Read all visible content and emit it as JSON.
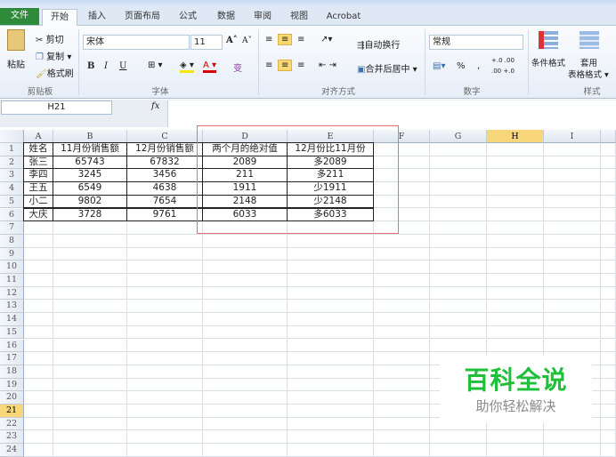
{
  "tabs": [
    "文件",
    "开始",
    "插入",
    "页面布局",
    "公式",
    "数据",
    "审阅",
    "视图",
    "Acrobat"
  ],
  "ribbon": {
    "clipboard": {
      "paste": "粘贴",
      "cut": "剪切",
      "copy": "复制 ▾",
      "format_painter": "格式刷",
      "label": "剪贴板"
    },
    "font": {
      "name": "宋体",
      "size": "11",
      "grow": "A˄",
      "shrink": "A˅",
      "bold": "B",
      "italic": "I",
      "underline": "U",
      "label": "字体",
      "wen": "变"
    },
    "alignment": {
      "wrap": "自动换行",
      "merge": "合并后居中 ▾",
      "label": "对齐方式"
    },
    "number": {
      "format": "常规",
      "percent": "%",
      "comma": ",",
      "inc": "+.0 .00",
      "dec": ".00 +.0",
      "label": "数字"
    },
    "styles": {
      "conditional": "条件格式",
      "table": "套用",
      "table2": "表格格式 ▾",
      "label": "样式"
    }
  },
  "formula_bar": {
    "name_box": "H21",
    "fx": "fx",
    "value": ""
  },
  "sheet": {
    "columns": [
      "A",
      "B",
      "C",
      "D",
      "E",
      "F",
      "G",
      "H",
      "I"
    ],
    "selected_col": "H",
    "selected_row": 21,
    "rows": [
      [
        "姓名",
        "11月份销售额",
        "12月份销售额",
        "两个月的绝对值",
        "12月份比11月份"
      ],
      [
        "张三",
        "65743",
        "67832",
        "2089",
        "多2089"
      ],
      [
        "李四",
        "3245",
        "3456",
        "211",
        "多211"
      ],
      [
        "王五",
        "6549",
        "4638",
        "1911",
        "少1911"
      ],
      [
        "小二",
        "9802",
        "7654",
        "2148",
        "少2148"
      ],
      [
        "大庆",
        "3728",
        "9761",
        "6033",
        "多6033"
      ]
    ],
    "row_count": 24
  },
  "watermark": {
    "title": "百科全说",
    "subtitle": "助你轻松解决"
  },
  "colors": {
    "accent": "#2e8b3a",
    "highlight": "#e07474",
    "watermark": "#1fbf3a"
  }
}
